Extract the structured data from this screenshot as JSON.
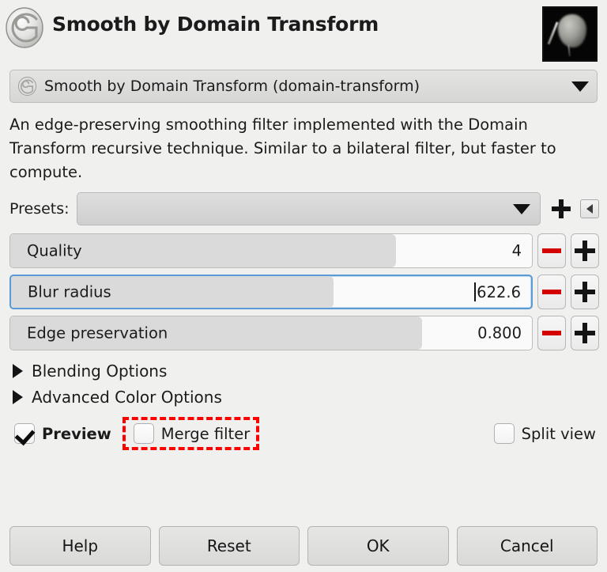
{
  "dialog": {
    "title": "Smooth by Domain Transform",
    "logo_icon": "gimp-wilber-icon",
    "thumbnail_icon": "image-preview-thumbnail"
  },
  "operation": {
    "icon": "gimp-wilber-icon",
    "label": "Smooth by Domain Transform (domain-transform)",
    "dropdown_icon": "chevron-down-icon"
  },
  "description": "An edge-preserving smoothing filter implemented with the Domain Transform recursive technique. Similar to a bilateral filter, but faster to compute.",
  "presets": {
    "label": "Presets:",
    "value": "",
    "dropdown_icon": "chevron-down-icon",
    "add_icon": "plus-icon",
    "menu_icon": "chevron-left-icon"
  },
  "sliders": [
    {
      "name": "Quality",
      "value": "4",
      "fill_percent": 74,
      "focused": false,
      "has_caret": false,
      "minus_icon": "minus-icon",
      "plus_icon": "plus-icon"
    },
    {
      "name": "Blur radius",
      "value": "622.6",
      "fill_percent": 62,
      "focused": true,
      "has_caret": true,
      "minus_icon": "minus-icon",
      "plus_icon": "plus-icon"
    },
    {
      "name": "Edge preservation",
      "value": "0.800",
      "fill_percent": 79,
      "focused": false,
      "has_caret": false,
      "minus_icon": "minus-icon",
      "plus_icon": "plus-icon"
    }
  ],
  "expanders": [
    {
      "label": "Blending Options",
      "icon": "triangle-right-icon",
      "expanded": false
    },
    {
      "label": "Advanced Color Options",
      "icon": "triangle-right-icon",
      "expanded": false
    }
  ],
  "checkboxes": {
    "preview": {
      "label": "Preview",
      "checked": true
    },
    "merge_filter": {
      "label": "Merge filter",
      "checked": false,
      "highlighted": true
    },
    "split_view": {
      "label": "Split view",
      "checked": false
    }
  },
  "buttons": [
    {
      "label": "Help"
    },
    {
      "label": "Reset"
    },
    {
      "label": "OK"
    },
    {
      "label": "Cancel"
    }
  ],
  "colors": {
    "background": "#f0f0ef",
    "focus_border": "#5b9bd5",
    "minus_red": "#d40000",
    "highlight_red": "#ff0000",
    "slider_fill": "#dadada"
  }
}
